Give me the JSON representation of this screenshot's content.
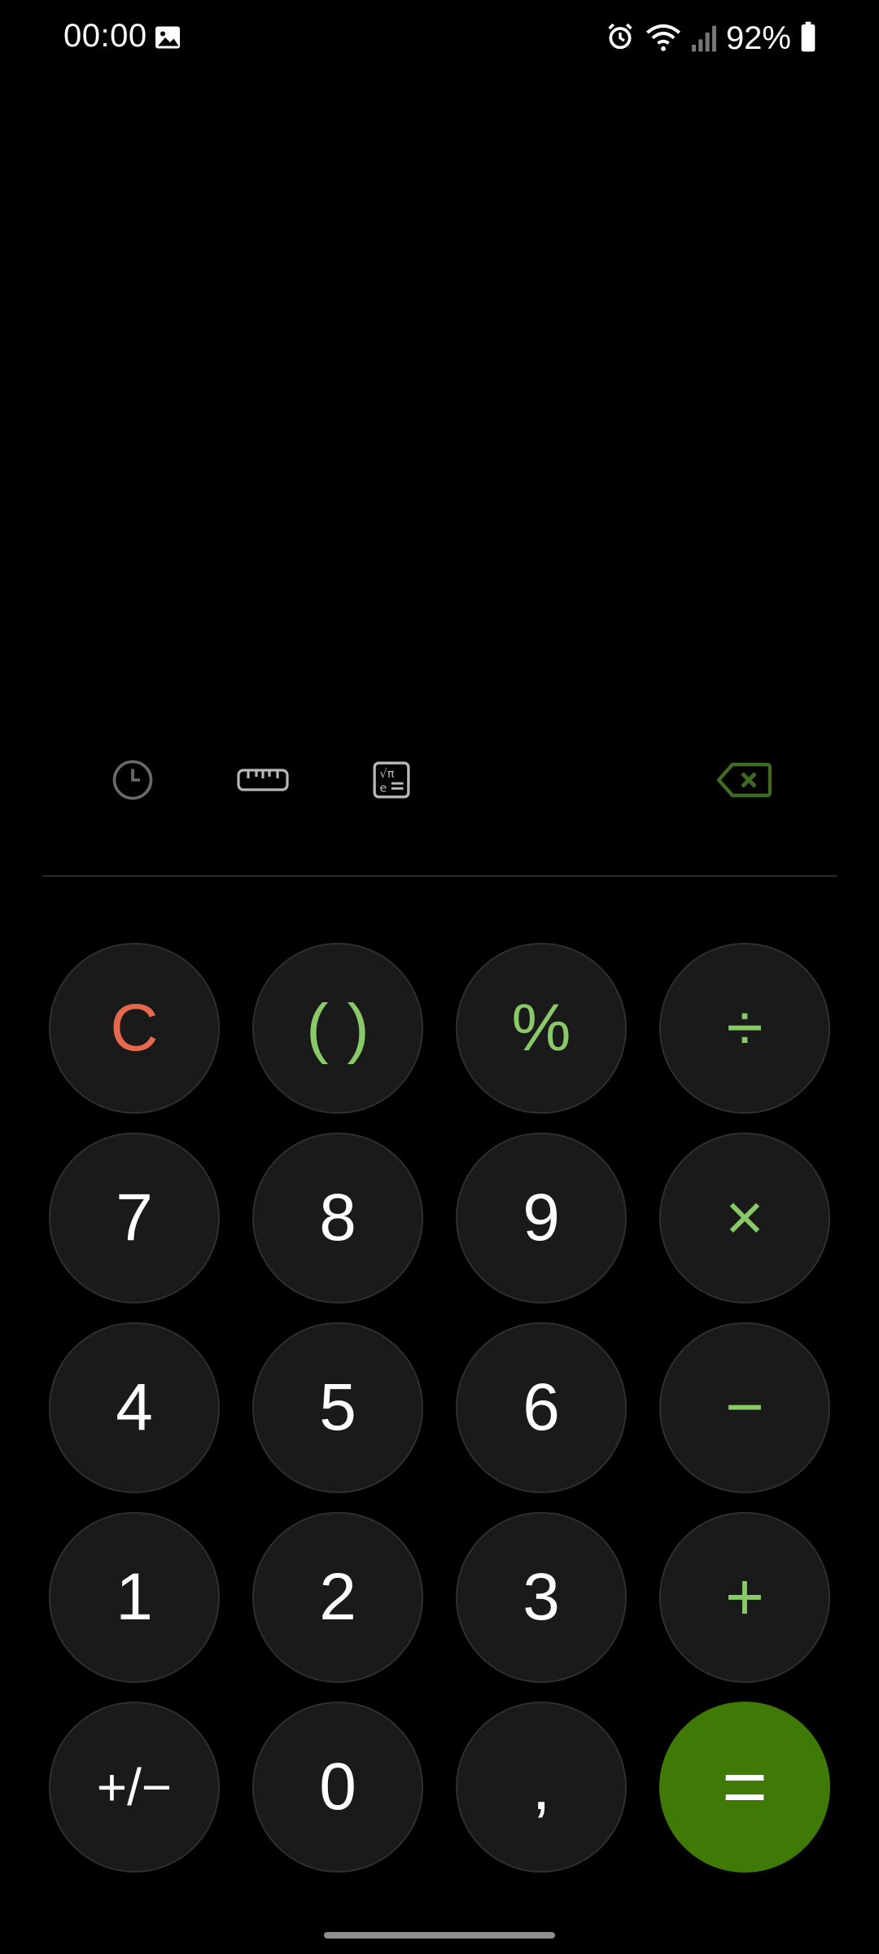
{
  "status_bar": {
    "time": "00:00",
    "battery_percent": "92%",
    "icons": [
      "gallery-icon",
      "alarm-icon",
      "wifi-icon",
      "signal-icon",
      "battery-icon"
    ]
  },
  "display": {
    "expression": "",
    "result": ""
  },
  "tools": {
    "history_icon": "history-icon",
    "unit_icon": "unit-converter-icon",
    "scientific_icon": "scientific-mode-icon",
    "backspace_icon": "backspace-icon"
  },
  "keypad": {
    "row1": [
      "C",
      "( )",
      "%",
      "÷"
    ],
    "row2": [
      "7",
      "8",
      "9",
      "×"
    ],
    "row3": [
      "4",
      "5",
      "6",
      "−"
    ],
    "row4": [
      "1",
      "2",
      "3",
      "+"
    ],
    "row5": [
      "+/−",
      "0",
      ",",
      "="
    ]
  },
  "colors": {
    "background": "#000000",
    "key_bg": "#1a1a1a",
    "operator": "#8ac967",
    "clear": "#e56a4d",
    "equals_bg": "#3f7a06"
  }
}
